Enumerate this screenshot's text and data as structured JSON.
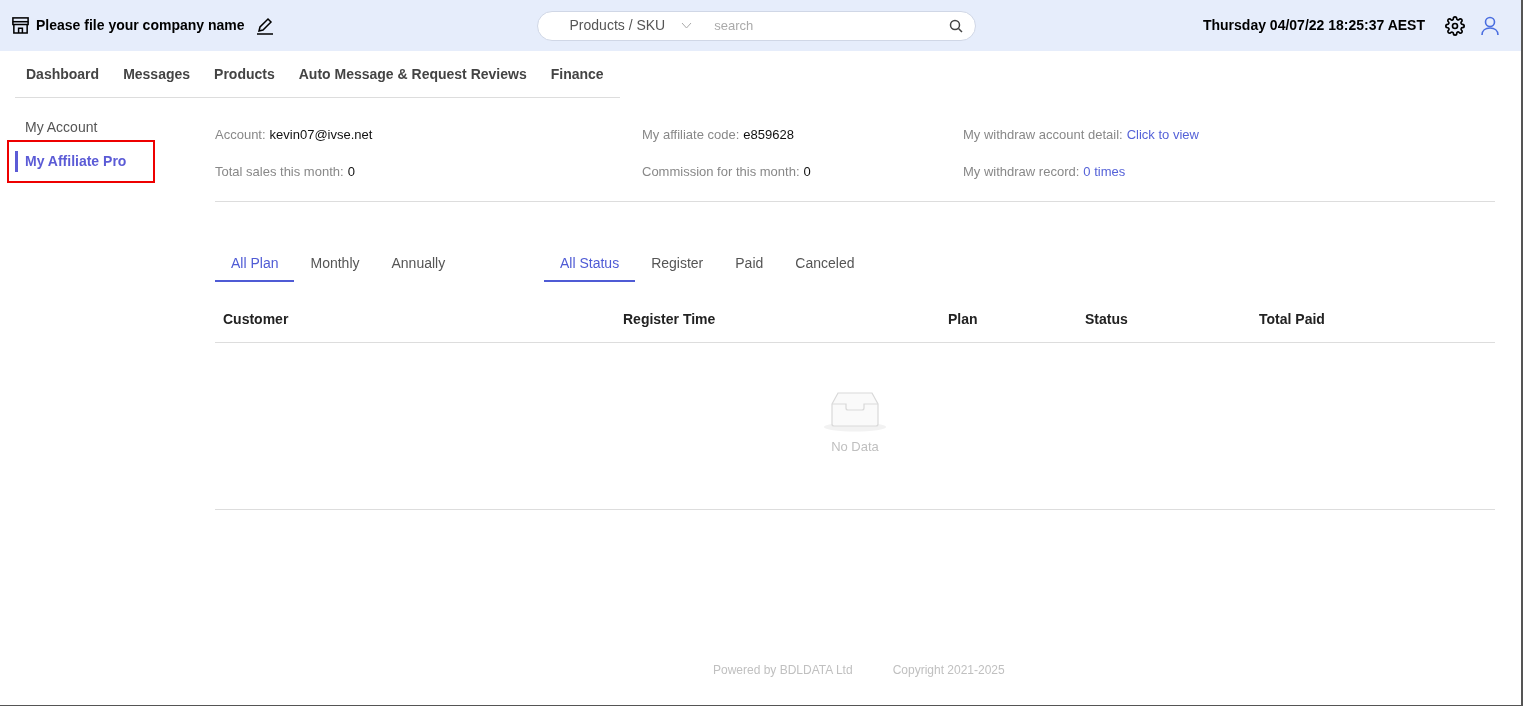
{
  "header": {
    "company_name": "Please file your company name",
    "search": {
      "scope": "Products / SKU",
      "placeholder": "search"
    },
    "datetime": "Thursday 04/07/22 18:25:37 AEST"
  },
  "nav": [
    {
      "label": "Dashboard",
      "selected": false
    },
    {
      "label": "Messages",
      "selected": false
    },
    {
      "label": "Products",
      "selected": false
    },
    {
      "label": "Auto Message & Request Reviews",
      "selected": false
    },
    {
      "label": "Finance",
      "selected": false
    }
  ],
  "sidebar": {
    "items": [
      {
        "label": "My Account",
        "selected": false,
        "highlighted": false
      },
      {
        "label": "My Affiliate Pro",
        "selected": true,
        "highlighted": true
      }
    ]
  },
  "info": [
    {
      "label": "Account:",
      "value": "kevin07@ivse.net",
      "link": false
    },
    {
      "label": "My affiliate code:",
      "value": "e859628",
      "link": false
    },
    {
      "label": "My withdraw account detail:",
      "value": "Click to view",
      "link": true
    },
    {
      "label": "Total sales this month:",
      "value": "0",
      "link": false
    },
    {
      "label": "Commission for this month:",
      "value": "0",
      "link": false
    },
    {
      "label": "My withdraw record:",
      "value": "0 times",
      "link": true
    }
  ],
  "plan_tabs": [
    {
      "label": "All Plan",
      "selected": true
    },
    {
      "label": "Monthly",
      "selected": false
    },
    {
      "label": "Annually",
      "selected": false
    }
  ],
  "status_tabs": [
    {
      "label": "All Status",
      "selected": true
    },
    {
      "label": "Register",
      "selected": false
    },
    {
      "label": "Paid",
      "selected": false
    },
    {
      "label": "Canceled",
      "selected": false
    }
  ],
  "table": {
    "columns": [
      "Customer",
      "Register Time",
      "Plan",
      "Status",
      "Total Paid"
    ],
    "empty_text": "No Data"
  },
  "footer": [
    "Powered by BDLDATA Ltd",
    "Copyright 2021-2025"
  ]
}
